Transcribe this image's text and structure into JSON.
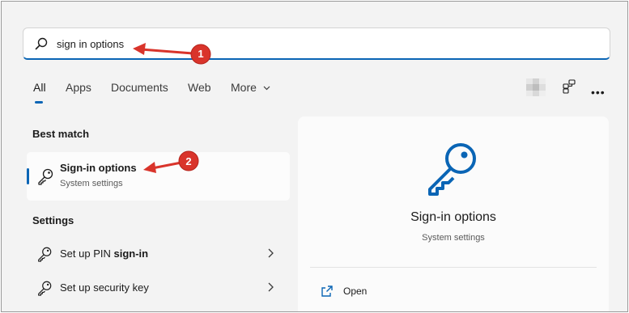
{
  "search": {
    "query": "sign in options"
  },
  "tabs": [
    {
      "label": "All",
      "active": true
    },
    {
      "label": "Apps"
    },
    {
      "label": "Documents"
    },
    {
      "label": "Web"
    },
    {
      "label": "More"
    }
  ],
  "best_match": {
    "heading": "Best match",
    "title": "Sign-in options",
    "subtitle": "System settings"
  },
  "settings": {
    "heading": "Settings",
    "items": [
      {
        "prefix": "Set up PIN ",
        "bold": "sign-in"
      },
      {
        "prefix": "Set up security key",
        "bold": ""
      }
    ]
  },
  "detail": {
    "title": "Sign-in options",
    "subtitle": "System settings",
    "open_label": "Open"
  },
  "annotations": [
    {
      "number": "1"
    },
    {
      "number": "2"
    }
  ],
  "colors": {
    "accent": "#0a65b5",
    "annotation": "#d9342b",
    "panel_bg": "#f3f3f3"
  },
  "icons": {
    "search": "search-icon",
    "key": "key-icon",
    "org": "org-chart-icon",
    "more": "more-dots-icon",
    "open": "open-external-icon"
  }
}
